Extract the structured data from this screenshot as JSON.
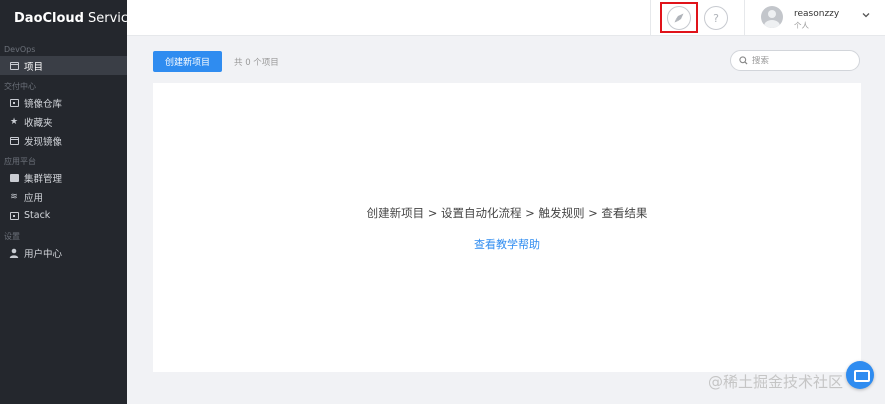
{
  "brand": {
    "bold": "DaoCloud",
    "normal": "Services"
  },
  "sidebar": {
    "sections": [
      {
        "label": "DevOps",
        "items": [
          {
            "label": "项目",
            "icon": "folder-icon",
            "active": true
          }
        ]
      },
      {
        "label": "交付中心",
        "items": [
          {
            "label": "镜像仓库",
            "icon": "image-repo-icon"
          },
          {
            "label": "收藏夹",
            "icon": "star-icon"
          },
          {
            "label": "发现镜像",
            "icon": "discover-icon"
          }
        ]
      },
      {
        "label": "应用平台",
        "items": [
          {
            "label": "集群管理",
            "icon": "cluster-icon"
          },
          {
            "label": "应用",
            "icon": "layers-icon"
          },
          {
            "label": "Stack",
            "icon": "stack-icon"
          }
        ]
      },
      {
        "label": "设置",
        "items": [
          {
            "label": "用户中心",
            "icon": "user-icon"
          }
        ]
      }
    ]
  },
  "header": {
    "help_symbol": "?",
    "user": {
      "name": "reasonzzy",
      "role": "个人"
    }
  },
  "toolbar": {
    "create_label": "创建新项目",
    "count_text": "共 0 个项目",
    "search_placeholder": "搜索"
  },
  "empty_state": {
    "flow_text": "创建新项目 > 设置自动化流程 > 触发规则 > 查看结果",
    "tutorial_link": "查看教学帮助"
  },
  "watermark": "@稀土掘金技术社区",
  "colors": {
    "accent": "#2f8cf0",
    "sidebar_bg": "#24272d",
    "highlight_border": "#e0131a"
  }
}
